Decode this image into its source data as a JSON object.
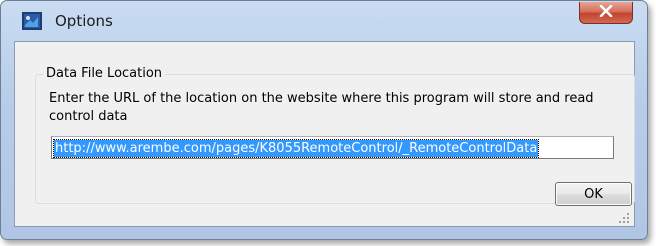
{
  "window": {
    "title": "Options",
    "icon": "app-icon",
    "close_icon": "close-icon"
  },
  "group": {
    "label": "Data File Location",
    "instructions": "Enter the URL of the location on the website where this program will store and read control data"
  },
  "url_field": {
    "value": "http://www.arembe.com/pages/K8055RemoteControl/_RemoteControlData"
  },
  "buttons": {
    "ok_label": "OK"
  },
  "colors": {
    "selection": "#3399ff",
    "close_button": "#c4432d",
    "frame": "#b8cde8"
  }
}
